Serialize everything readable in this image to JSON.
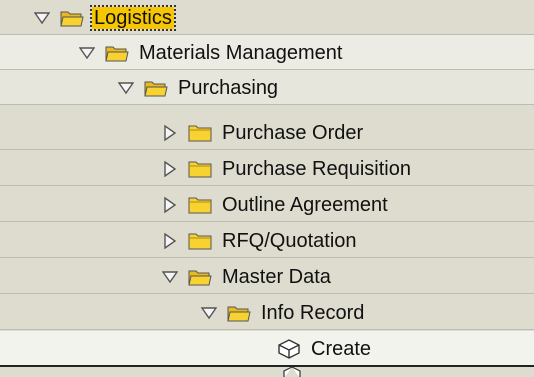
{
  "tree": {
    "nodes": [
      {
        "label": "Logistics",
        "state": "expanded",
        "selected": true
      },
      {
        "label": "Materials Management",
        "state": "expanded"
      },
      {
        "label": "Purchasing",
        "state": "expanded"
      },
      {
        "label": "Purchase Order",
        "state": "collapsed"
      },
      {
        "label": "Purchase Requisition",
        "state": "collapsed"
      },
      {
        "label": "Outline Agreement",
        "state": "collapsed"
      },
      {
        "label": "RFQ/Quotation",
        "state": "collapsed"
      },
      {
        "label": "Master Data",
        "state": "expanded"
      },
      {
        "label": "Info Record",
        "state": "expanded"
      },
      {
        "label": "Create",
        "state": "transaction"
      }
    ]
  },
  "colors": {
    "background": "#dedccf",
    "selection": "#f6c600",
    "folder": "#f7d230"
  },
  "icons": {
    "expanded": "triangle-down-icon",
    "collapsed": "triangle-right-icon",
    "open_folder": "open-folder-icon",
    "closed_folder": "closed-folder-icon",
    "transaction": "cube-icon"
  }
}
